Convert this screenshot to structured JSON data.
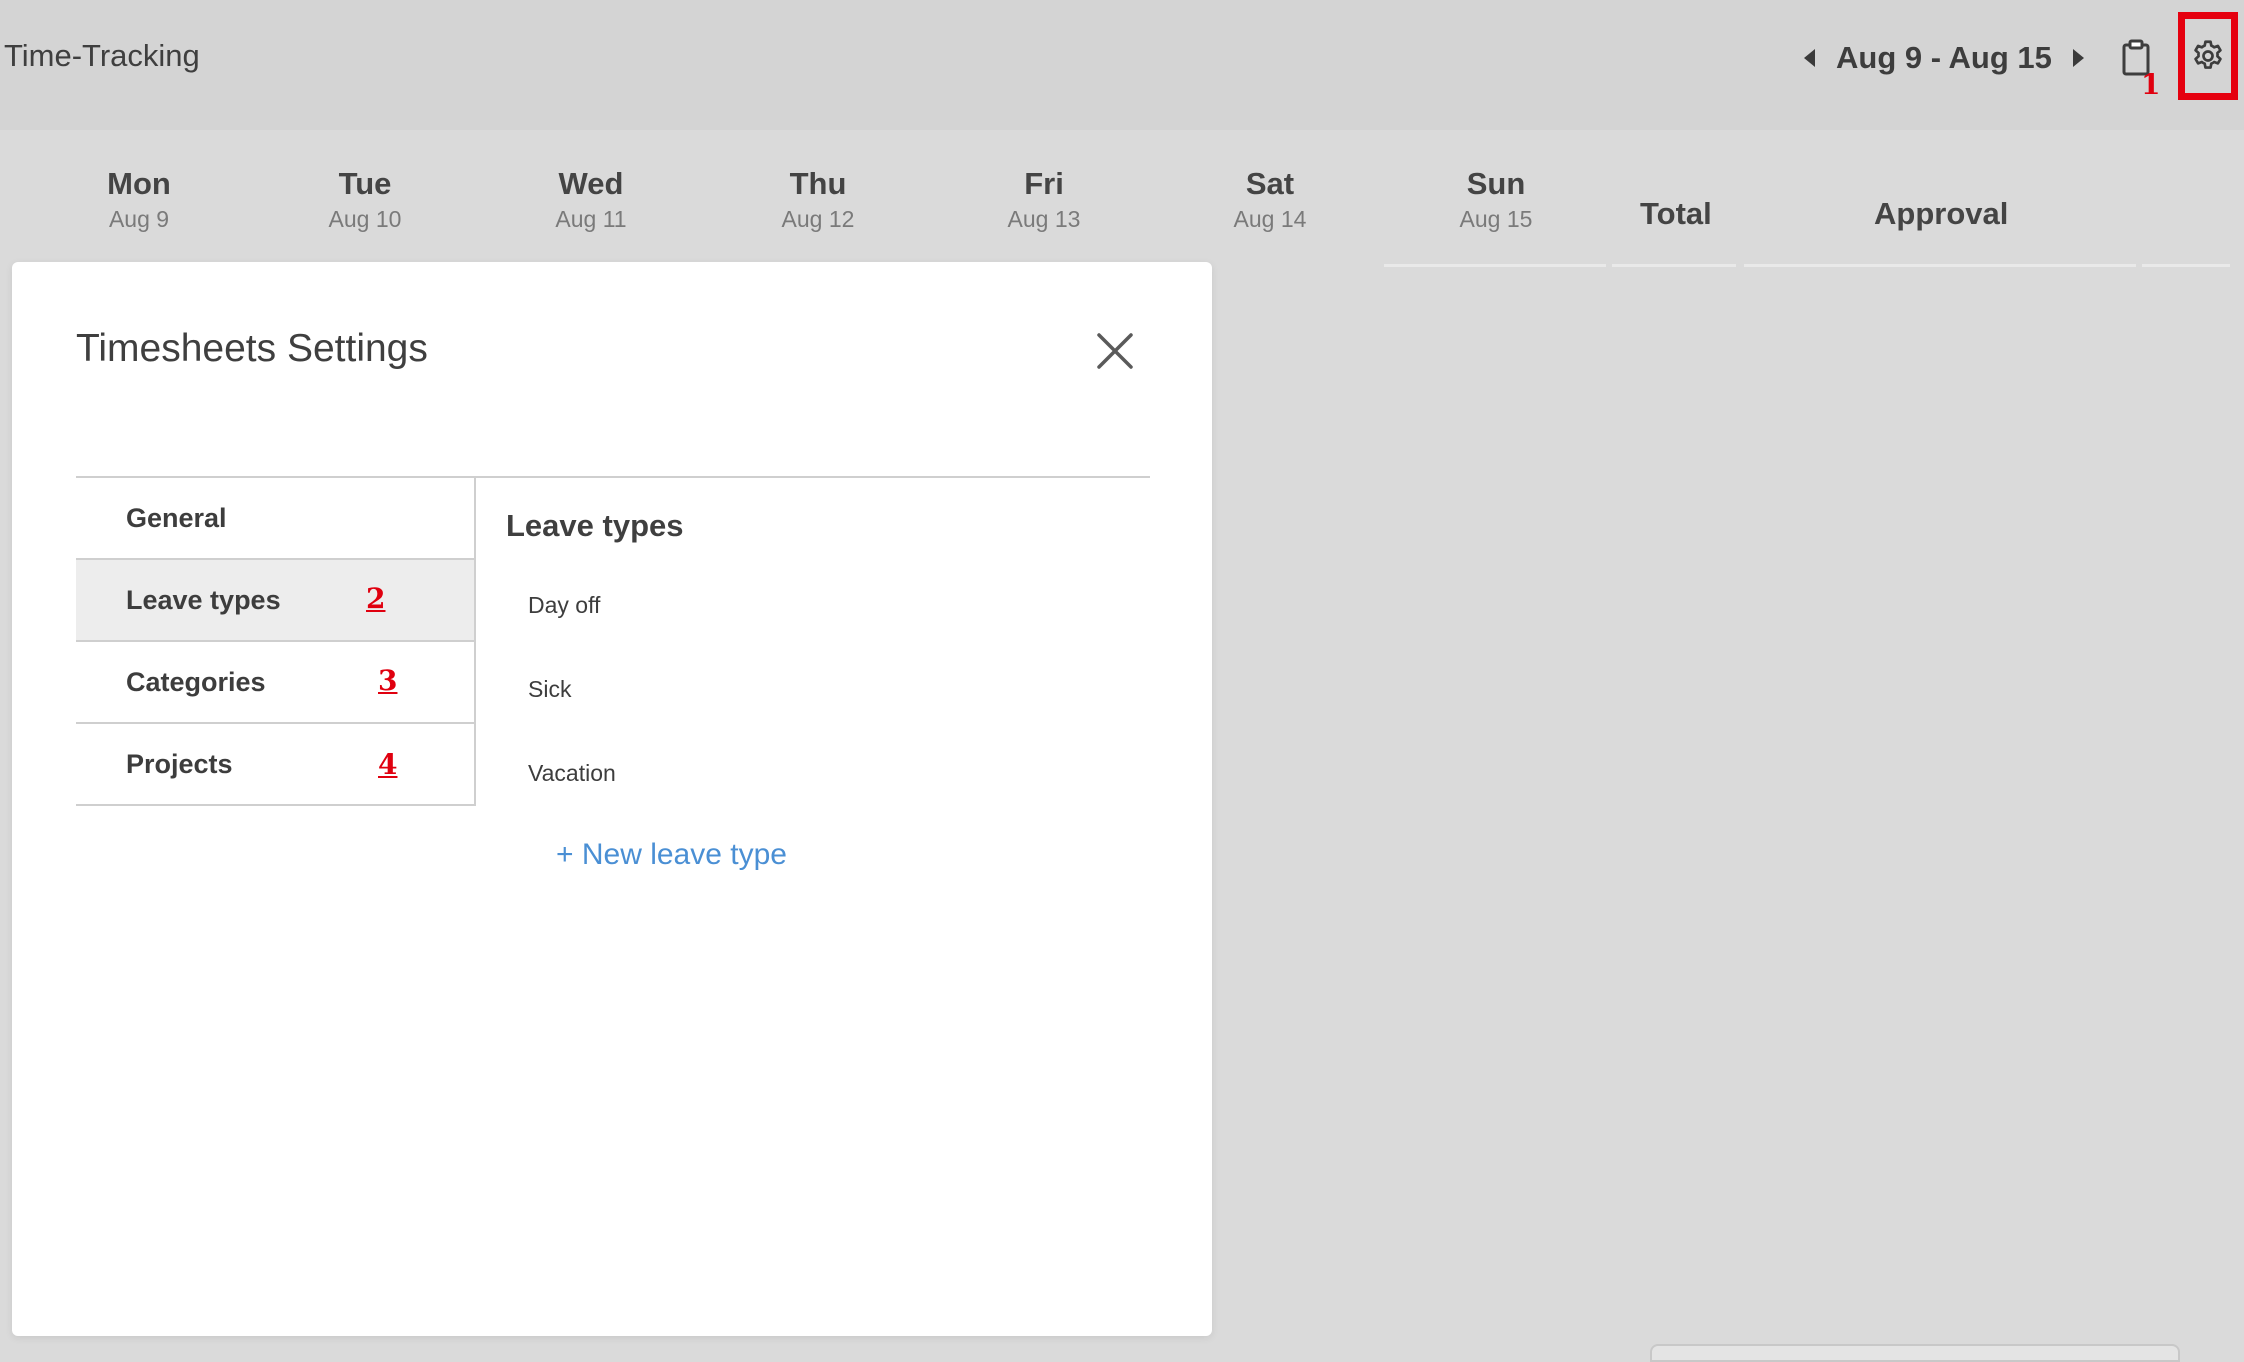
{
  "header": {
    "title": "Time-Tracking",
    "week_range": "Aug 9 - Aug 15"
  },
  "annotations": {
    "marker_1": "1",
    "marker_2": "2",
    "marker_3": "3",
    "marker_4": "4",
    "highlight_color": "#e5000f"
  },
  "week": {
    "days": [
      {
        "name": "Mon",
        "date": "Aug 9"
      },
      {
        "name": "Tue",
        "date": "Aug 10"
      },
      {
        "name": "Wed",
        "date": "Aug 11"
      },
      {
        "name": "Thu",
        "date": "Aug 12"
      },
      {
        "name": "Fri",
        "date": "Aug 13"
      },
      {
        "name": "Sat",
        "date": "Aug 14"
      },
      {
        "name": "Sun",
        "date": "Aug 15"
      }
    ],
    "total_label": "Total",
    "approval_label": "Approval"
  },
  "modal": {
    "title": "Timesheets Settings",
    "menu": [
      {
        "label": "General",
        "active": false
      },
      {
        "label": "Leave types",
        "active": true
      },
      {
        "label": "Categories",
        "active": false
      },
      {
        "label": "Projects",
        "active": false
      }
    ],
    "section_title": "Leave types",
    "leave_types": [
      "Day off",
      "Sick",
      "Vacation"
    ],
    "new_leave_label": "+ New leave type",
    "link_color": "#4a8fd4"
  }
}
